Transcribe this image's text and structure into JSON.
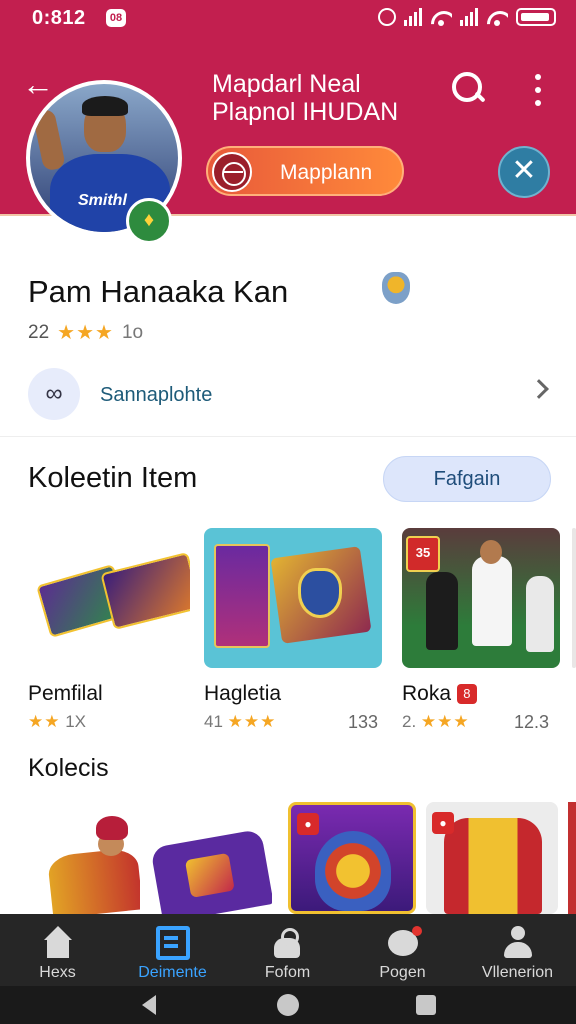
{
  "status_bar": {
    "time": "0:812",
    "app_badge": "08"
  },
  "header": {
    "title_line1": "Mapdarl Neal",
    "title_line2": "Plapnol IHUDAN",
    "action_button_label": "Mapplann",
    "avatar_jersey_text": "Smithl",
    "icons": [
      "back-arrow-icon",
      "search-icon",
      "more-vert-icon",
      "close-icon",
      "team-crest-icon"
    ]
  },
  "profile": {
    "name": "Pam Hanaaka Kan",
    "rating_value": "22",
    "stars": "★★★",
    "rating_suffix": "1o",
    "link_label": "Sannaplohte"
  },
  "collection": {
    "title": "Koleetin Item",
    "button_label": "Fafgain",
    "cards": [
      {
        "title": "Pemfilal",
        "meta_prefix": "",
        "stars": "★★",
        "meta_suffix": "1X",
        "count": ""
      },
      {
        "title": "Hagletia",
        "meta_prefix": "41",
        "stars": "★★★",
        "meta_suffix": "",
        "count": "133"
      },
      {
        "title": "Roka",
        "title_badge": "8",
        "meta_prefix": "2.",
        "stars": "★★★",
        "meta_suffix": "",
        "count": "12.3"
      }
    ],
    "thumb_badge": "35"
  },
  "collection2": {
    "title": "Kolecis"
  },
  "bottom_nav": {
    "items": [
      {
        "label": "Hexs",
        "icon": "home-icon"
      },
      {
        "label": "Deimente",
        "icon": "document-icon",
        "active": true
      },
      {
        "label": "Fofom",
        "icon": "bag-icon"
      },
      {
        "label": "Pogen",
        "icon": "chat-icon"
      },
      {
        "label": "Vllenerion",
        "icon": "user-icon"
      }
    ]
  },
  "colors": {
    "header_red": "#c21f4f",
    "accent_orange": "#ff8a3a",
    "active_blue": "#3aa3ff",
    "star_gold": "#f5a623"
  }
}
